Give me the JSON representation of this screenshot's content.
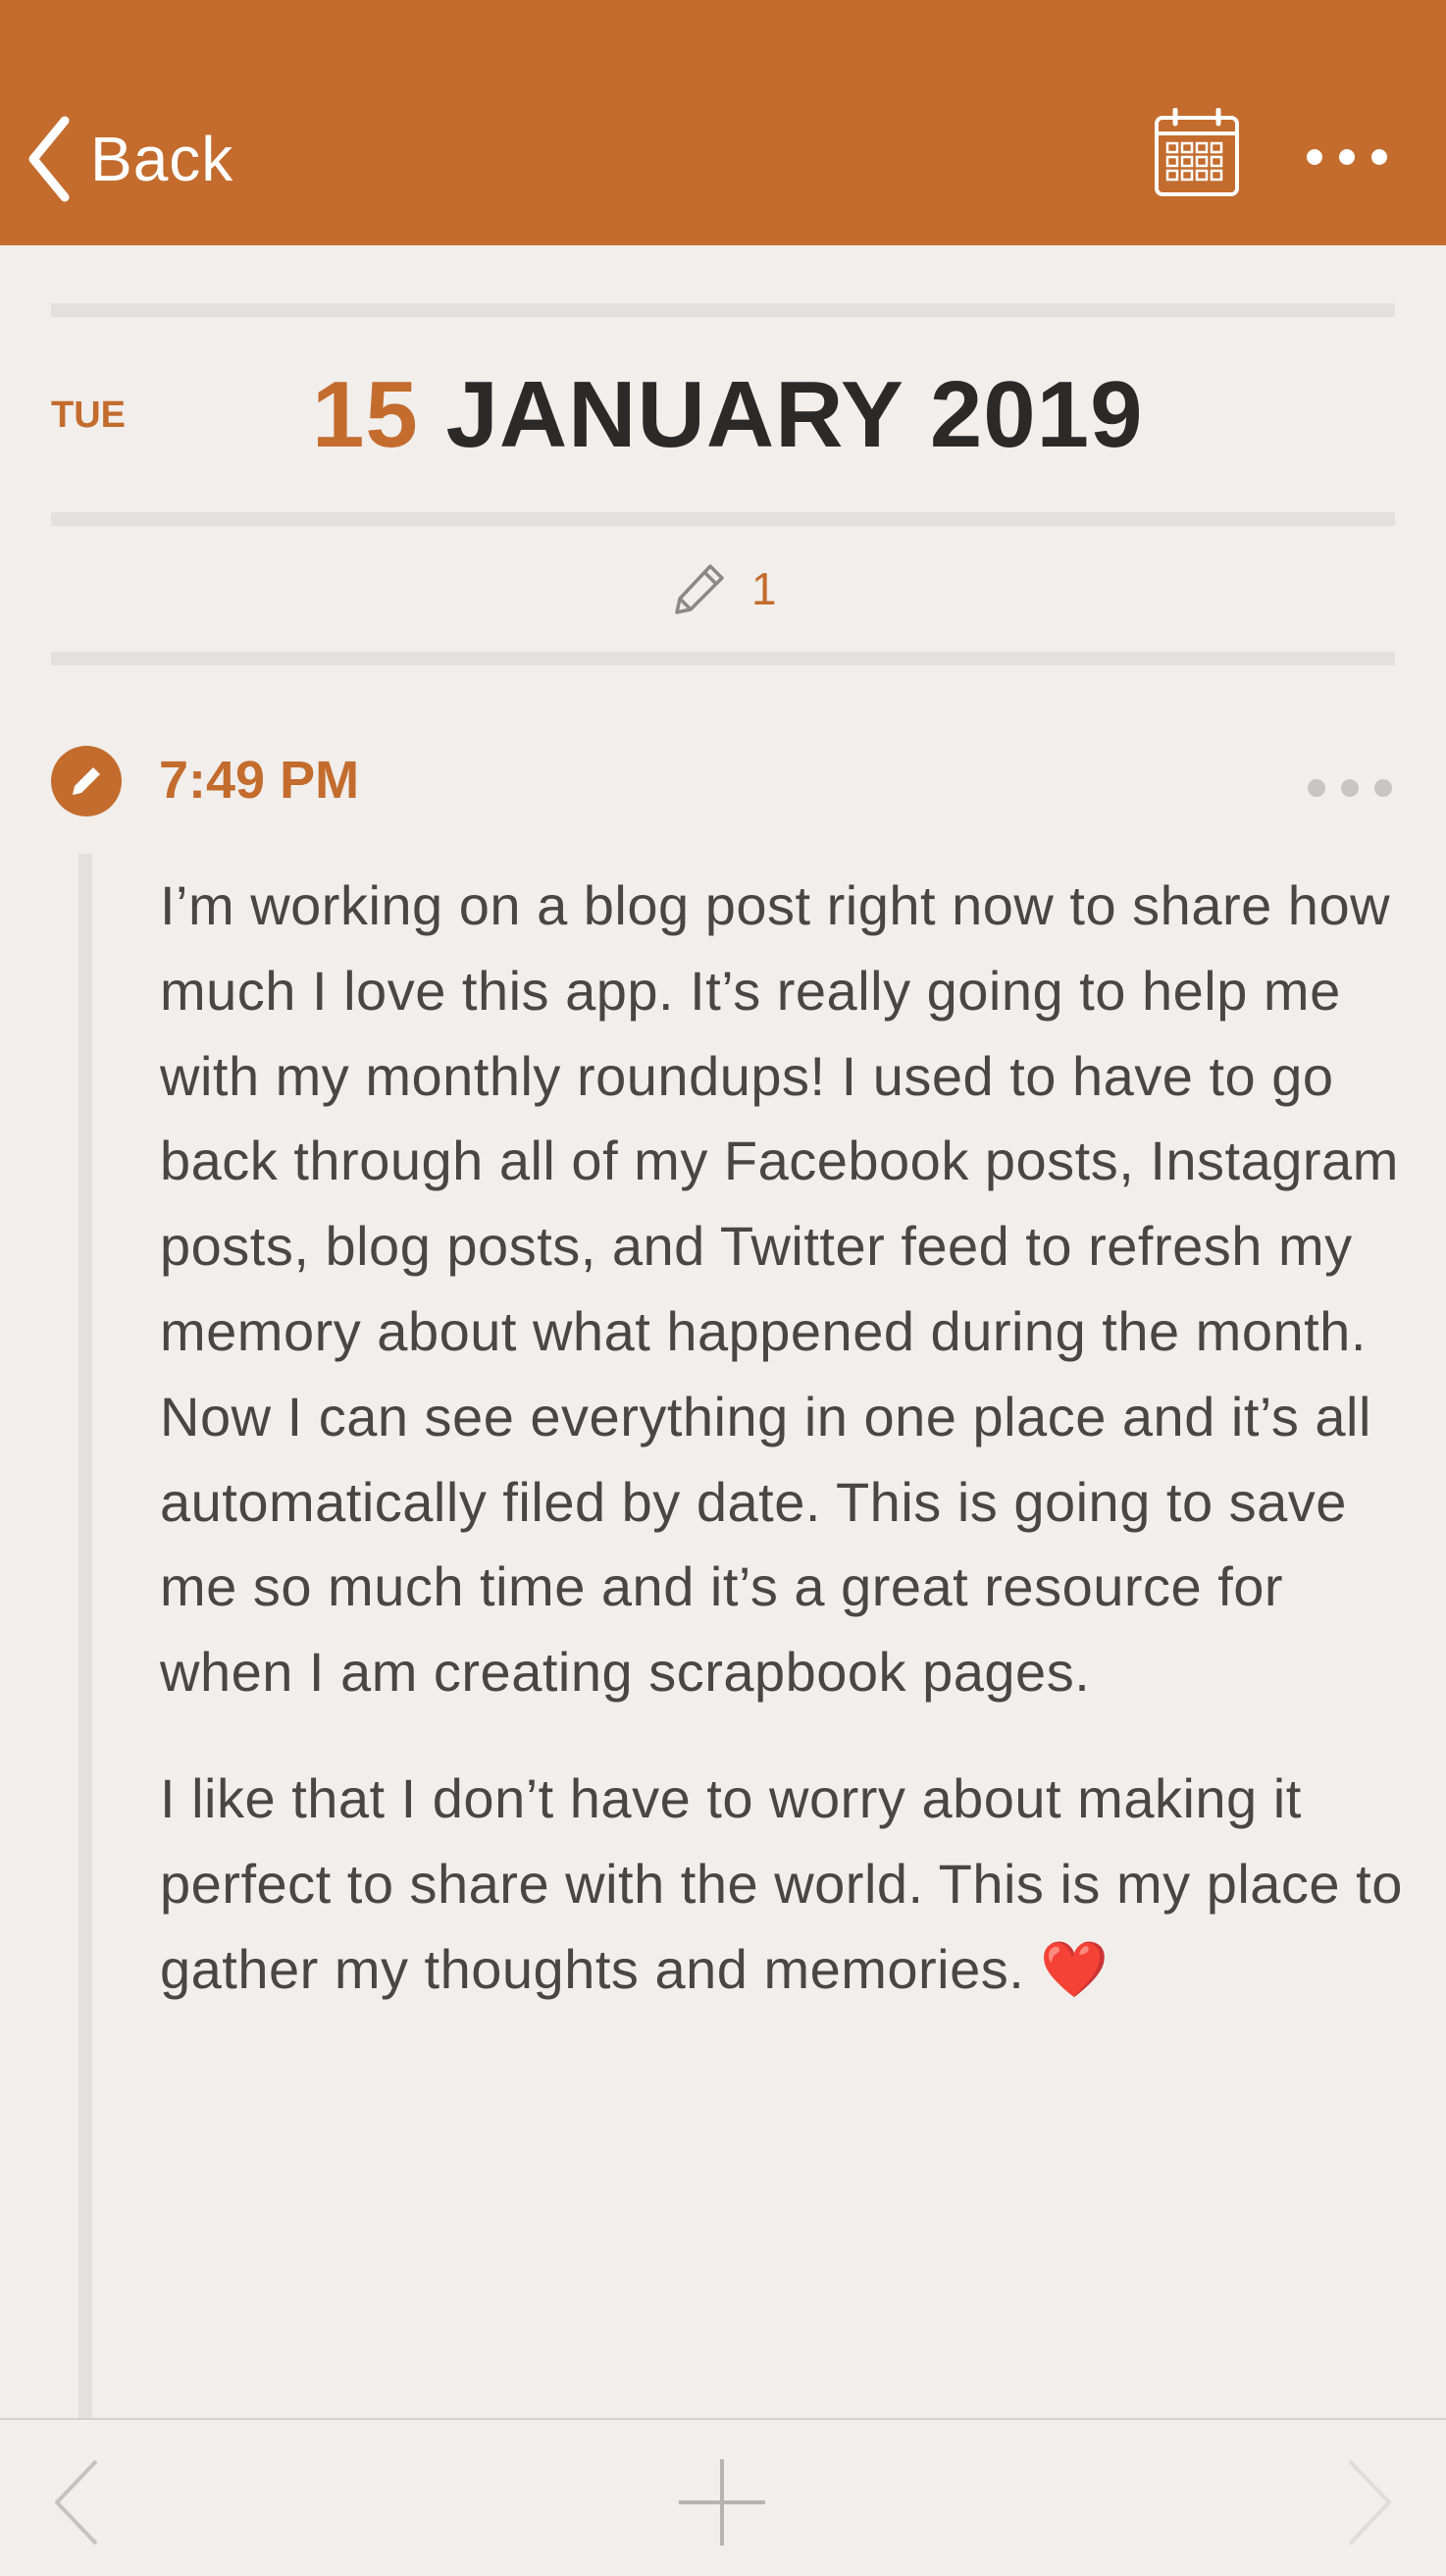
{
  "header": {
    "back_label": "Back",
    "icons": [
      "chevron-left-icon",
      "calendar-icon",
      "more-horizontal-icon"
    ],
    "background_color": "#c36c2e"
  },
  "day": {
    "weekday": "TUE",
    "date_number": "15",
    "month_year": "JANUARY 2019",
    "entry_count": "1",
    "count_icon": "pencil-icon"
  },
  "entry": {
    "time": "7:49 PM",
    "icon": "pencil-icon",
    "paragraphs": [
      "I’m working on a blog post right now to share how much I love this app. It’s really going to help me with my monthly roundups! I used to have to go back through all of my Facebook posts, Instagram posts, blog posts, and Twitter feed to refresh my memory about what happened during the month. Now I can see everything in one place and it’s all automatically filed by date. This is going to save me so much time and it’s a great resource for when I am creating scrapbook pages.",
      "I like that I don’t have to worry about making it perfect to share with the world. This is my place to gather my thoughts and memories."
    ],
    "emoji": "❤️"
  },
  "footer": {
    "icons": [
      "chevron-left-icon",
      "plus-icon",
      "chevron-right-icon"
    ]
  },
  "colors": {
    "accent": "#c36c2e",
    "background": "#f1eeeb",
    "text": "#4a4644",
    "heading": "#2c2a29"
  }
}
